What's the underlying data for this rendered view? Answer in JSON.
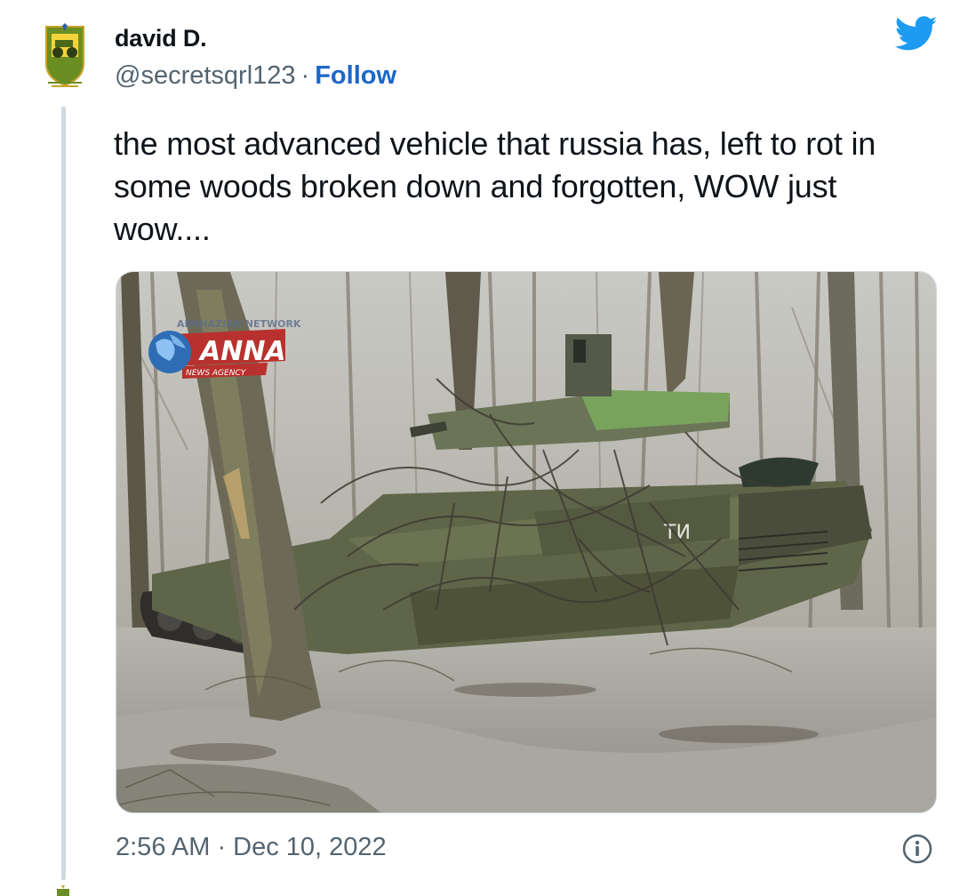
{
  "tweet": {
    "display_name": "david D.",
    "handle": "@secretsqrl123",
    "separator": "·",
    "follow_label": "Follow",
    "text": "the most advanced vehicle that russia has, left to rot in some woods broken down and forgotten, WOW just wow....",
    "timestamp": "2:56 AM · Dec 10, 2022"
  },
  "media": {
    "watermark_brand": "ANNA",
    "watermark_subtitle": "NEWS AGENCY",
    "watermark_top": "ABKHAZIAN NETWORK",
    "vehicle_marking": "ТИ"
  },
  "icons": {
    "brand": "twitter-bird-icon",
    "info": "info-icon",
    "avatar": "avatar-emblem"
  },
  "colors": {
    "follow_link": "#1d66c9",
    "twitter_blue": "#1d9bf0",
    "secondary_text": "#536471",
    "thread_line": "#cfd9de"
  }
}
